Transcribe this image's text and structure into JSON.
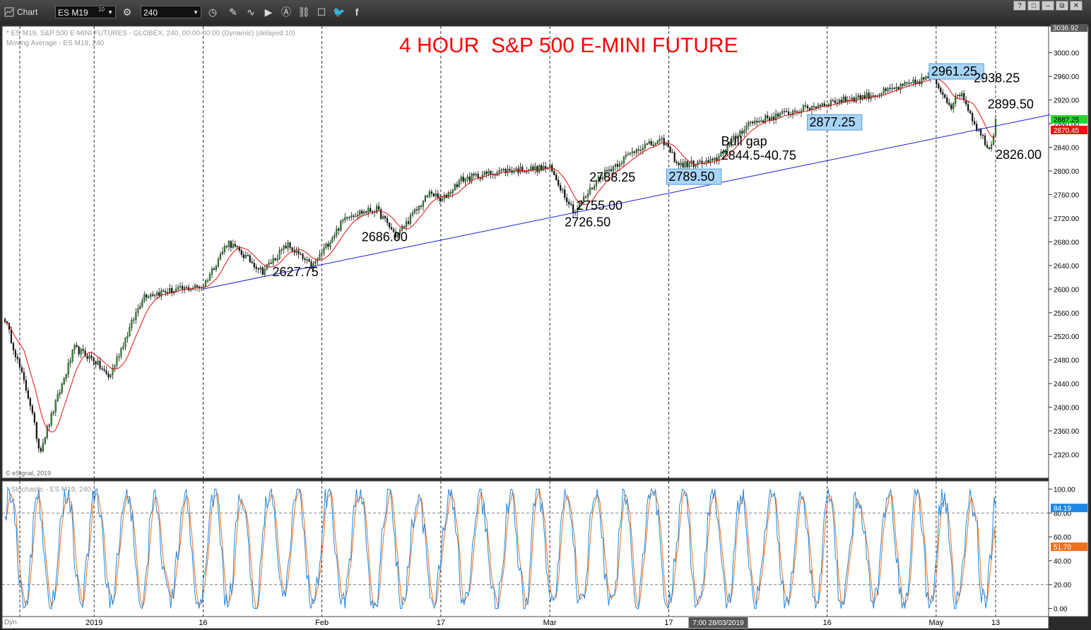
{
  "toolbar": {
    "app_label": "Chart",
    "symbol": "ES M19",
    "symbol_badge": "10",
    "interval": "240",
    "window_buttons": [
      "?",
      "□",
      "–",
      "⧉",
      "✕"
    ]
  },
  "header": {
    "line1": "* ES M19, S&P 500 E-MINI FUTURES - GLOBEX, 240, 00:00-00:00 (Dynamic) (delayed 10)",
    "line2": "Moving Average - ES M19, 240",
    "copyright": "© eSignal, 2019"
  },
  "lower_header": "* Stochastic - ES M19, 240",
  "bottom_left_label": "Dyn",
  "colors": {
    "title": "#ff0000",
    "up_candle": "#2e9d2e",
    "down_candle": "#111111",
    "moving_average": "#e01010",
    "trendline": "#1a1ae6",
    "stoch_k": "#1e88e5",
    "stoch_d": "#f07020",
    "highlight_box": "#a8d4f5",
    "last_up_tag": "#2fd12f",
    "last_down_tag": "#ee1111"
  },
  "chart_data": [
    {
      "type": "candlestick",
      "title": "4 HOUR  S&P 500 E-MINI FUTURE",
      "ylim": [
        2280,
        3045
      ],
      "y_ticks": [
        "2320.00",
        "2360.00",
        "2400.00",
        "2440.00",
        "2480.00",
        "2520.00",
        "2560.00",
        "2600.00",
        "2640.00",
        "2680.00",
        "2720.00",
        "2760.00",
        "2800.00",
        "2840.00",
        "2880.00",
        "2920.00",
        "2960.00",
        "3000.00"
      ],
      "y_ticks_values": [
        2320,
        2360,
        2400,
        2440,
        2480,
        2520,
        2560,
        2600,
        2640,
        2680,
        2720,
        2760,
        2800,
        2840,
        2880,
        2920,
        2960,
        3000
      ],
      "top_tag": "3036.92",
      "x_labels": [
        "2019",
        "16",
        "Feb",
        "17",
        "Mar",
        "17",
        "16",
        "May",
        "13"
      ],
      "x_label_times": [
        0.09,
        0.2,
        0.32,
        0.44,
        0.55,
        0.67,
        0.83,
        0.94,
        1.0
      ],
      "crosshair_label": "7:00 28/03/2019",
      "crosshair_time": 0.72,
      "anchors": [
        [
          0.0,
          2550
        ],
        [
          0.025,
          2410
        ],
        [
          0.035,
          2325
        ],
        [
          0.07,
          2500
        ],
        [
          0.09,
          2480
        ],
        [
          0.105,
          2450
        ],
        [
          0.14,
          2590
        ],
        [
          0.2,
          2605
        ],
        [
          0.225,
          2680
        ],
        [
          0.26,
          2630
        ],
        [
          0.285,
          2675
        ],
        [
          0.31,
          2637
        ],
        [
          0.345,
          2725
        ],
        [
          0.375,
          2735
        ],
        [
          0.395,
          2690
        ],
        [
          0.43,
          2765
        ],
        [
          0.44,
          2748
        ],
        [
          0.46,
          2785
        ],
        [
          0.5,
          2800
        ],
        [
          0.55,
          2805
        ],
        [
          0.575,
          2730
        ],
        [
          0.6,
          2790
        ],
        [
          0.64,
          2840
        ],
        [
          0.665,
          2850
        ],
        [
          0.68,
          2810
        ],
        [
          0.715,
          2815
        ],
        [
          0.75,
          2880
        ],
        [
          0.79,
          2898
        ],
        [
          0.83,
          2915
        ],
        [
          0.88,
          2930
        ],
        [
          0.92,
          2950
        ],
        [
          0.935,
          2961
        ],
        [
          0.955,
          2910
        ],
        [
          0.965,
          2935
        ],
        [
          0.98,
          2875
        ],
        [
          0.995,
          2835
        ],
        [
          1.0,
          2887
        ]
      ],
      "moving_average_label": "Moving Average - ES M19, 240",
      "trendline": {
        "start": [
          0.2,
          2600
        ],
        "end": [
          1.055,
          2895
        ]
      },
      "last_price_up": "2887.25",
      "last_price_up_value": 2887.25,
      "last_price_down": "2870.45",
      "last_price_down_value": 2870.45,
      "annotations": [
        {
          "text": "2961.25",
          "time": 0.935,
          "value": 2961.25,
          "boxed": true
        },
        {
          "text": "2938.25",
          "time": 0.978,
          "value": 2950,
          "boxed": false
        },
        {
          "text": "2899.50",
          "time": 0.992,
          "value": 2906,
          "boxed": false
        },
        {
          "text": "2877.25",
          "time": 0.812,
          "value": 2875,
          "boxed": true
        },
        {
          "text": "Bull gap",
          "time": 0.723,
          "value": 2843,
          "boxed": false
        },
        {
          "text": "2844.5-40.75",
          "time": 0.723,
          "value": 2819,
          "boxed": false
        },
        {
          "text": "2826.00",
          "time": 1.0,
          "value": 2820,
          "boxed": false
        },
        {
          "text": "2788.25",
          "time": 0.59,
          "value": 2782,
          "boxed": false
        },
        {
          "text": "2789.50",
          "time": 0.67,
          "value": 2783,
          "boxed": true
        },
        {
          "text": "2755.00",
          "time": 0.577,
          "value": 2734,
          "boxed": false
        },
        {
          "text": "2726.50",
          "time": 0.565,
          "value": 2706,
          "boxed": false
        },
        {
          "text": "2686.00",
          "time": 0.36,
          "value": 2681,
          "boxed": false
        },
        {
          "text": "2627.75",
          "time": 0.27,
          "value": 2622,
          "boxed": false
        }
      ]
    },
    {
      "type": "line",
      "title": "* Stochastic - ES M19, 240",
      "ylim": [
        -5,
        105
      ],
      "y_ticks": [
        "0.00",
        "20.00",
        "40.00",
        "60.00",
        "80.00",
        "100.00"
      ],
      "y_ticks_values": [
        0,
        20,
        40,
        60,
        80,
        100
      ],
      "reference_lines": [
        20,
        80
      ],
      "series": [
        {
          "tag": "84.19",
          "last": 84.19
        },
        {
          "tag": "51.70",
          "last": 51.7
        }
      ]
    }
  ]
}
